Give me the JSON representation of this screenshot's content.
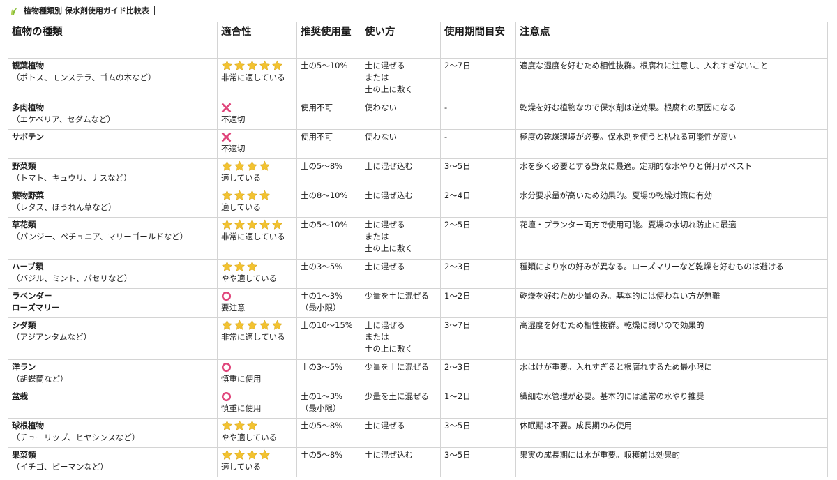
{
  "title": "植物種類別 保水剤使用ガイド比較表",
  "colors": {
    "star": "#f2c230",
    "cross": "#e0457b",
    "circle": "#e0457b",
    "border": "#d4d4d4"
  },
  "headers": [
    "植物の種類",
    "適合性",
    "推奨使用量",
    "使い方",
    "使用期間目安",
    "注意点"
  ],
  "rows": [
    {
      "name": "観葉植物",
      "note": "（ポトス、モンステラ、ゴムの木など）",
      "mark": "stars",
      "count": 5,
      "suit": "非常に適している",
      "amount": "土の5〜10%",
      "amount2": "",
      "usage": [
        "土に混ぜる",
        "または",
        "土の上に敷く"
      ],
      "period": "2〜7日",
      "caution": "適度な湿度を好むため相性抜群。根腐れに注意し、入れすぎないこと"
    },
    {
      "name": "多肉植物",
      "note": "（エケベリア、セダムなど）",
      "mark": "cross",
      "count": 0,
      "suit": "不適切",
      "amount": "使用不可",
      "amount2": "",
      "usage": [
        "使わない"
      ],
      "period": "-",
      "caution": "乾燥を好む植物なので保水剤は逆効果。根腐れの原因になる"
    },
    {
      "name": "サボテン",
      "note": "",
      "mark": "cross",
      "count": 0,
      "suit": "不適切",
      "amount": "使用不可",
      "amount2": "",
      "usage": [
        "使わない"
      ],
      "period": "-",
      "caution": "極度の乾燥環境が必要。保水剤を使うと枯れる可能性が高い"
    },
    {
      "name": "野菜類",
      "note": "（トマト、キュウリ、ナスなど）",
      "mark": "stars",
      "count": 4,
      "suit": "適している",
      "amount": "土の5〜8%",
      "amount2": "",
      "usage": [
        "土に混ぜ込む"
      ],
      "period": "3〜5日",
      "caution": "水を多く必要とする野菜に最適。定期的な水やりと併用がベスト"
    },
    {
      "name": "葉物野菜",
      "note": "（レタス、ほうれん草など）",
      "mark": "stars",
      "count": 4,
      "suit": "適している",
      "amount": "土の8〜10%",
      "amount2": "",
      "usage": [
        "土に混ぜ込む"
      ],
      "period": "2〜4日",
      "caution": "水分要求量が高いため効果的。夏場の乾燥対策に有効"
    },
    {
      "name": "草花類",
      "note": "（パンジー、ペチュニア、マリーゴールドなど）",
      "mark": "stars",
      "count": 5,
      "suit": "非常に適している",
      "amount": "土の5〜10%",
      "amount2": "",
      "usage": [
        "土に混ぜる",
        "または",
        "土の上に敷く"
      ],
      "period": "2〜5日",
      "caution": "花壇・プランター両方で使用可能。夏場の水切れ防止に最適"
    },
    {
      "name": "ハーブ類",
      "note": "（バジル、ミント、パセリなど）",
      "mark": "stars",
      "count": 3,
      "suit": "やや適している",
      "amount": "土の3〜5%",
      "amount2": "",
      "usage": [
        "土に混ぜる"
      ],
      "period": "2〜3日",
      "caution": "種類により水の好みが異なる。ローズマリーなど乾燥を好むものは避ける"
    },
    {
      "name": "ラベンダー",
      "name2": "ローズマリー",
      "note": "",
      "mark": "circle",
      "count": 0,
      "suit": "要注意",
      "amount": "土の1〜3%",
      "amount2": "（最小限）",
      "usage": [
        "少量を土に混ぜる"
      ],
      "period": "1〜2日",
      "caution": "乾燥を好むため少量のみ。基本的には使わない方が無難"
    },
    {
      "name": "シダ類",
      "note": "（アジアンタムなど）",
      "mark": "stars",
      "count": 5,
      "suit": "非常に適している",
      "amount": "土の10〜15%",
      "amount2": "",
      "usage": [
        "土に混ぜる",
        "または",
        "土の上に敷く"
      ],
      "period": "3〜7日",
      "caution": "高湿度を好むため相性抜群。乾燥に弱いので効果的"
    },
    {
      "name": "洋ラン",
      "note": "（胡蝶蘭など）",
      "mark": "circle",
      "count": 0,
      "suit": "慎重に使用",
      "amount": "土の3〜5%",
      "amount2": "",
      "usage": [
        "少量を土に混ぜる"
      ],
      "period": "2〜3日",
      "caution": "水はけが重要。入れすぎると根腐れするため最小限に"
    },
    {
      "name": "盆栽",
      "note": "",
      "mark": "circle",
      "count": 0,
      "suit": "慎重に使用",
      "amount": "土の1〜3%",
      "amount2": "（最小限）",
      "usage": [
        "少量を土に混ぜる"
      ],
      "period": "1〜2日",
      "caution": "繊細な水管理が必要。基本的には通常の水やり推奨"
    },
    {
      "name": "球根植物",
      "note": "（チューリップ、ヒヤシンスなど）",
      "mark": "stars",
      "count": 3,
      "suit": "やや適している",
      "amount": "土の5〜8%",
      "amount2": "",
      "usage": [
        "土に混ぜる"
      ],
      "period": "3〜5日",
      "caution": "休眠期は不要。成長期のみ使用"
    },
    {
      "name": "果菜類",
      "note": "（イチゴ、ピーマンなど）",
      "mark": "stars",
      "count": 4,
      "suit": "適している",
      "amount": "土の5〜8%",
      "amount2": "",
      "usage": [
        "土に混ぜ込む"
      ],
      "period": "3〜5日",
      "caution": "果実の成長期には水が重要。収穫前は効果的"
    }
  ]
}
